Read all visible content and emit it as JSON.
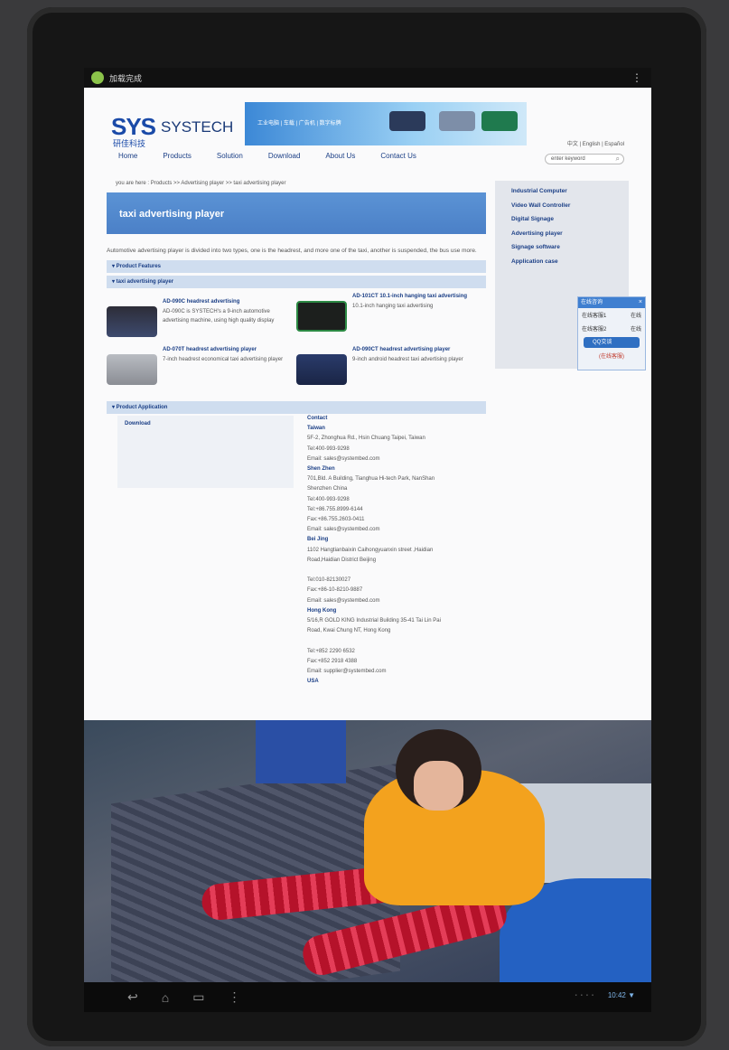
{
  "status_bar": {
    "app_name": "加载完成",
    "menu": "⋮"
  },
  "header": {
    "logo_mark": "SYS",
    "logo_name": "SYSTECH",
    "logo_cn": "研佳科技",
    "banner_text": "工业电脑 | 车载 | 广告机 | 数字标牌",
    "language": "中文 | English | Español",
    "search_placeholder": "enter keyword"
  },
  "nav": [
    "Home",
    "Products",
    "Solution",
    "Download",
    "About Us",
    "Contact Us"
  ],
  "breadcrumb": "you are here : Products >> Advertising player >> taxi advertising player",
  "page_title": "taxi advertising player",
  "intro": "Automotive advertising player is divided into two types, one is the headrest, and more one of the taxi, another is suspended, the bus use more.",
  "sections": {
    "features": "▾ Product Features",
    "player": "▾ taxi advertising player",
    "application": "▾ Product Application"
  },
  "products": [
    {
      "title": "AD-090C headrest advertising",
      "desc": "AD-090C is SYSTECH's a 9-inch automotive advertising machine, using high quality display"
    },
    {
      "title": "AD-101CT 10.1-inch hanging taxi advertising",
      "desc": "10.1-inch hanging taxi advertising"
    },
    {
      "title": "AD-070T headrest advertising player",
      "desc": "7-inch headrest economical taxi advertising player"
    },
    {
      "title": "AD-090CT headrest advertising player",
      "desc": "9-inch android headrest taxi advertising player"
    }
  ],
  "download_label": "Download",
  "contact": {
    "heading": "Contact",
    "lines": [
      {
        "text": "Taiwan",
        "bold": true
      },
      {
        "text": "5F-2, Zhonghua Rd., Hsin Chuang Taipei, Taiwan",
        "bold": false
      },
      {
        "text": "Tel:400-993-9298",
        "bold": false
      },
      {
        "text": "Email: sales@systembed.com",
        "bold": false
      },
      {
        "text": "Shen Zhen",
        "bold": true
      },
      {
        "text": "701,Bld. A Building, Tianghua Hi-tech Park, NanShan",
        "bold": false
      },
      {
        "text": "Shenzhen China",
        "bold": false
      },
      {
        "text": "Tel:400-993-9298",
        "bold": false
      },
      {
        "text": "Tel:+86.755.8999-6144",
        "bold": false
      },
      {
        "text": "Fax:+86.755.2603-0411",
        "bold": false
      },
      {
        "text": "Email: sales@systembed.com",
        "bold": false
      },
      {
        "text": "Bei Jing",
        "bold": true
      },
      {
        "text": "1102 Hangtianbaixin Caihongyuanxin street ,Haidian",
        "bold": false
      },
      {
        "text": "Road,Haidian District Beijing",
        "bold": false
      },
      {
        "text": "",
        "bold": false
      },
      {
        "text": "Tel:010-82130027",
        "bold": false
      },
      {
        "text": "Fax:+86-10-8210-9887",
        "bold": false
      },
      {
        "text": "Email: sales@systembed.com",
        "bold": false
      },
      {
        "text": "Hong Kong",
        "bold": true
      },
      {
        "text": "5/16,R GOLD KING Industrial Building 35-41 Tai Lin Pai",
        "bold": false
      },
      {
        "text": "Road, Kwai Chung NT, Hong Kong",
        "bold": false
      },
      {
        "text": "",
        "bold": false
      },
      {
        "text": "Tel:+852 2290 6532",
        "bold": false
      },
      {
        "text": "Fax:+852 2918 4388",
        "bold": false
      },
      {
        "text": "Email: supplier@systembed.com",
        "bold": false
      },
      {
        "text": "USA",
        "bold": true
      }
    ]
  },
  "sidebar": [
    "Industrial Computer",
    "Video Wall Controller",
    "Digital Signage",
    "Advertising player",
    "Signage software",
    "Application case"
  ],
  "chat": {
    "title": "在线咨询",
    "close": "×",
    "rows": [
      {
        "label": "在线客服1",
        "status": "在线"
      },
      {
        "label": "在线客服2",
        "status": "在线"
      }
    ],
    "qq_button": "QQ交谈",
    "footer": "(在线客服)"
  },
  "navbar": {
    "back": "↩",
    "home": "⌂",
    "recent": "▭",
    "menu": "⋮",
    "clock": "10:42 ▼"
  },
  "colors": {
    "accent": "#4b80c7",
    "brand": "#1a4aa8",
    "sidebar_bg": "#e3e6ec"
  }
}
